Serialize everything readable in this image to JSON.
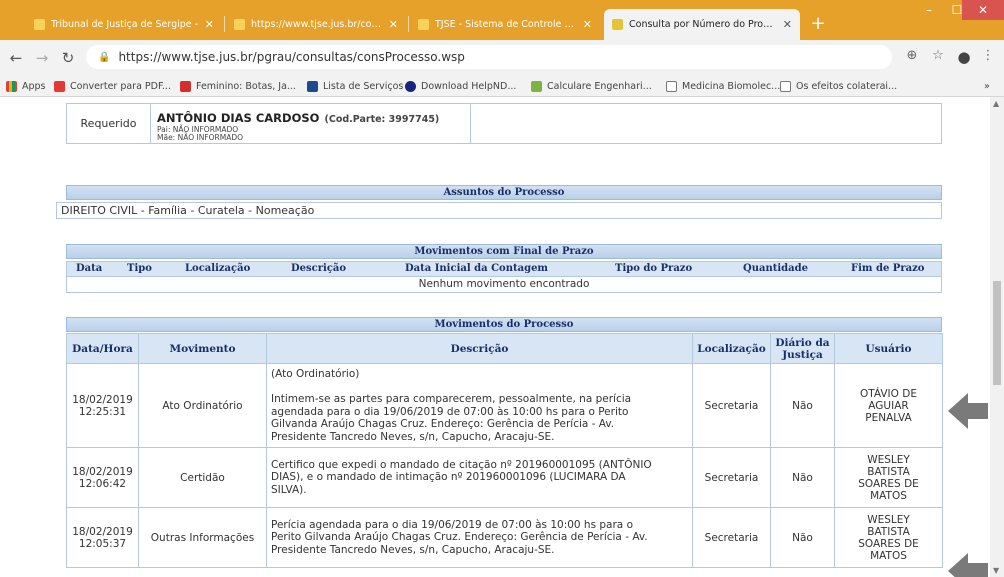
{
  "browser": {
    "tabs": [
      {
        "title": "Tribunal de Justiça de Sergipe - "
      },
      {
        "title": "https://www.tjse.jus.br/controleu"
      },
      {
        "title": "TJSE - Sistema de Controle Proce"
      },
      {
        "title": "Consulta por Número do Proces"
      }
    ],
    "url": "https://www.tjse.jus.br/pgrau/consultas/consProcesso.wsp",
    "bookmarks": [
      {
        "label": "Apps"
      },
      {
        "label": "Converter para PDF..."
      },
      {
        "label": "Feminino: Botas, Ja..."
      },
      {
        "label": "Lista de Serviços"
      },
      {
        "label": "Download HelpND..."
      },
      {
        "label": "Calculare Engenhari..."
      },
      {
        "label": "Medicina Biomolec..."
      },
      {
        "label": "Os efeitos colaterai..."
      }
    ],
    "overflow": "»"
  },
  "requerido": {
    "label": "Requerido",
    "name": "ANTÔNIO DIAS CARDOSO",
    "cod": "(Cod.Parte: 3997745)",
    "pai": "Pai: NÃO INFORMADO",
    "mae": "Mãe: NÃO INFORMADO"
  },
  "assuntos": {
    "title": "Assuntos do Processo",
    "value": "DIREITO CIVIL - Família - Curatela - Nomeação"
  },
  "prazo": {
    "title": "Movimentos com Final de Prazo",
    "columns": [
      "Data",
      "Tipo",
      "Localização",
      "Descrição",
      "Data Inicial da Contagem",
      "Tipo do Prazo",
      "Quantidade",
      "Fim de Prazo"
    ],
    "empty": "Nenhum movimento encontrado"
  },
  "movimentos": {
    "title": "Movimentos do Processo",
    "columns": [
      "Data/Hora",
      "Movimento",
      "Descrição",
      "Localização",
      "Diário da Justiça",
      "Usuário"
    ],
    "rows": [
      {
        "date": "18/02/2019",
        "time": "12:25:31",
        "movimento": "Ato Ordinatório",
        "desc": [
          "(Ato Ordinatório)",
          "",
          "Intimem-se as partes para comparecerem, pessoalmente, na perícia",
          "agendada para o dia 19/06/2019 de 07:00 às 10:00 hs para o Perito",
          "Gilvanda Araújo Chagas Cruz. Endereço: Gerência de Perícia - Av.",
          "Presidente Tancredo Neves, s/n, Capucho, Aracaju-SE."
        ],
        "local": "Secretaria",
        "diario": "Não",
        "usuario": [
          "OTÁVIO DE",
          "AGUIAR",
          "PENALVA"
        ]
      },
      {
        "date": "18/02/2019",
        "time": "12:06:42",
        "movimento": "Certidão",
        "desc": [
          "Certifico que expedi o mandado de citação nº 201960001095 (ANTÔNIO",
          "DIAS), e o mandado de intimação nº 201960001096 (LUCIMARA DA",
          "SILVA)."
        ],
        "local": "Secretaria",
        "diario": "Não",
        "usuario": [
          "WESLEY",
          "BATISTA",
          "SOARES DE",
          "MATOS"
        ]
      },
      {
        "date": "18/02/2019",
        "time": "12:05:37",
        "movimento": "Outras Informações",
        "desc": [
          "Perícia agendada para o dia 19/06/2019 de 07:00 às 10:00 hs para o",
          "Perito Gilvanda Araújo Chagas Cruz. Endereço: Gerência de Perícia - Av.",
          "Presidente Tancredo Neves, s/n, Capucho, Aracaju-SE."
        ],
        "local": "Secretaria",
        "diario": "Não",
        "usuario": [
          "WESLEY",
          "BATISTA",
          "SOARES DE",
          "MATOS"
        ]
      }
    ]
  },
  "colors": {
    "tabbar": "#e6a12a",
    "header_bg": "#d7e5f4",
    "header_text": "#1a2f66",
    "border": "#b5c9de",
    "arrow": "#7a7a7a"
  }
}
